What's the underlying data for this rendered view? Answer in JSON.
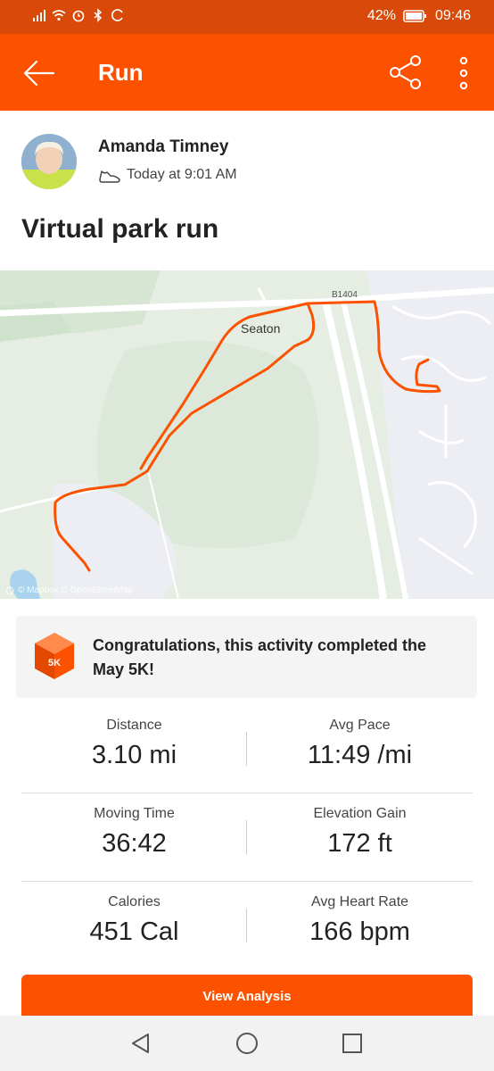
{
  "status_bar": {
    "battery": "42%",
    "time": "09:46",
    "icons": [
      "signal-icon",
      "wifi-icon",
      "alarm-icon",
      "bluetooth-icon",
      "sync-icon",
      "battery-icon"
    ]
  },
  "app_bar": {
    "title": "Run",
    "back_icon": "back-arrow-icon",
    "share_icon": "share-icon",
    "more_icon": "more-vert-icon"
  },
  "athlete": {
    "name": "Amanda Timney",
    "time": "Today at 9:01 AM",
    "sport_icon": "shoe-icon"
  },
  "activity": {
    "title": "Virtual park run"
  },
  "map": {
    "place_label": "Seaton",
    "road_label": "B1404",
    "credit": "© Mapbox © OpenStreetMap",
    "route_color": "#fc5200"
  },
  "challenge": {
    "badge_text": "5K",
    "text": "Congratulations, this activity completed the May 5K!"
  },
  "stats": [
    {
      "left_label": "Distance",
      "left_value": "3.10 mi",
      "right_label": "Avg Pace",
      "right_value": "11:49 /mi"
    },
    {
      "left_label": "Moving Time",
      "left_value": "36:42",
      "right_label": "Elevation Gain",
      "right_value": "172 ft"
    },
    {
      "left_label": "Calories",
      "left_value": "451 Cal",
      "right_label": "Avg Heart Rate",
      "right_value": "166 bpm"
    }
  ],
  "button": {
    "label": "View Analysis"
  },
  "colors": {
    "brand": "#fc5200",
    "status_bar": "#d94a0a"
  }
}
